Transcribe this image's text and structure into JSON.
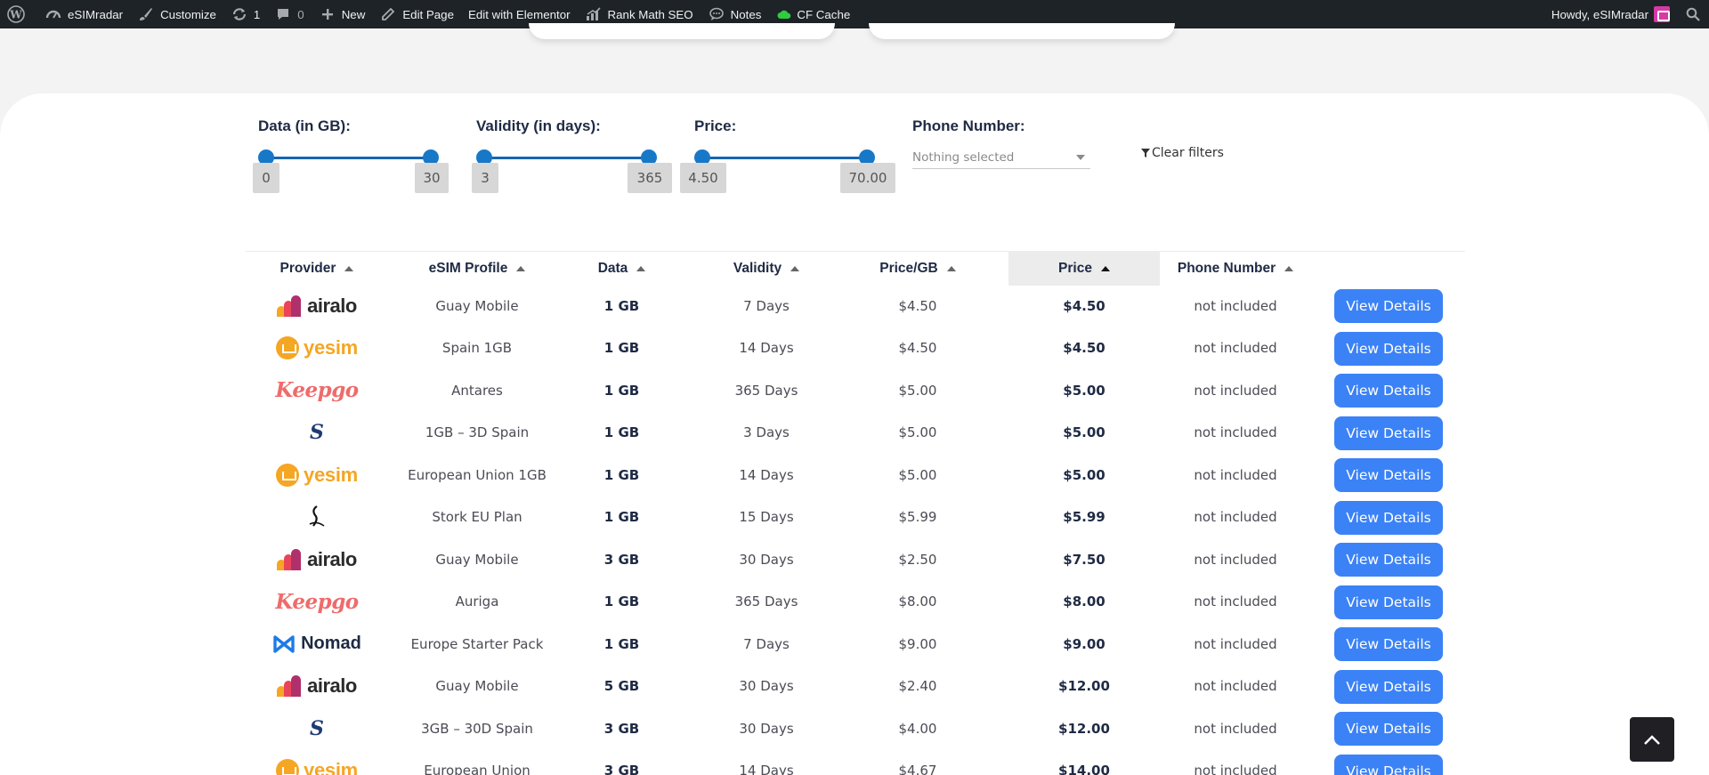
{
  "adminbar": {
    "items": [
      {
        "label": "eSIMradar",
        "icon": "dashboard-icon"
      },
      {
        "label": "Customize",
        "icon": "brush-icon"
      },
      {
        "label": "1",
        "icon": "updates-icon"
      },
      {
        "label": "0",
        "icon": "comments-icon"
      },
      {
        "label": "New",
        "icon": "plus-icon"
      },
      {
        "label": "Edit Page",
        "icon": "pencil-icon"
      },
      {
        "label": "Edit with Elementor",
        "icon": ""
      },
      {
        "label": "Rank Math SEO",
        "icon": "rankmath-icon"
      },
      {
        "label": "Notes",
        "icon": "chat-icon"
      },
      {
        "label": "CF Cache",
        "icon": "cloud-icon"
      }
    ],
    "greeting": "Howdy, eSIMradar"
  },
  "filters": {
    "data": {
      "label": "Data (in GB):",
      "min": "0",
      "max": "30"
    },
    "validity": {
      "label": "Validity (in days):",
      "min": "3",
      "max": "365"
    },
    "price": {
      "label": "Price:",
      "min": "4.50",
      "max": "70.00"
    },
    "phone": {
      "label": "Phone Number:",
      "placeholder": "Nothing selected"
    },
    "clear": "Clear filters"
  },
  "table": {
    "headers": [
      "Provider",
      "eSIM Profile",
      "Data",
      "Validity",
      "Price/GB",
      "Price",
      "Phone Number"
    ],
    "sorted_column": "Price",
    "button_label": "View Details",
    "rows": [
      {
        "provider": "airalo",
        "profile": "Guay Mobile",
        "data": "1 GB",
        "validity": "7 Days",
        "price_gb": "$4.50",
        "price": "$4.50",
        "phone": "not included"
      },
      {
        "provider": "yesim",
        "profile": "Spain 1GB",
        "data": "1 GB",
        "validity": "14 Days",
        "price_gb": "$4.50",
        "price": "$4.50",
        "phone": "not included"
      },
      {
        "provider": "Keepgo",
        "profile": "Antares",
        "data": "1 GB",
        "validity": "365 Days",
        "price_gb": "$5.00",
        "price": "$5.00",
        "phone": "not included"
      },
      {
        "provider": "S",
        "profile": "1GB – 3D Spain",
        "data": "1 GB",
        "validity": "3 Days",
        "price_gb": "$5.00",
        "price": "$5.00",
        "phone": "not included"
      },
      {
        "provider": "yesim",
        "profile": "European Union 1GB",
        "data": "1 GB",
        "validity": "14 Days",
        "price_gb": "$5.00",
        "price": "$5.00",
        "phone": "not included"
      },
      {
        "provider": "Stork",
        "profile": "Stork EU Plan",
        "data": "1 GB",
        "validity": "15 Days",
        "price_gb": "$5.99",
        "price": "$5.99",
        "phone": "not included"
      },
      {
        "provider": "airalo",
        "profile": "Guay Mobile",
        "data": "3 GB",
        "validity": "30 Days",
        "price_gb": "$2.50",
        "price": "$7.50",
        "phone": "not included"
      },
      {
        "provider": "Keepgo",
        "profile": "Auriga",
        "data": "1 GB",
        "validity": "365 Days",
        "price_gb": "$8.00",
        "price": "$8.00",
        "phone": "not included"
      },
      {
        "provider": "Nomad",
        "profile": "Europe Starter Pack",
        "data": "1 GB",
        "validity": "7 Days",
        "price_gb": "$9.00",
        "price": "$9.00",
        "phone": "not included"
      },
      {
        "provider": "airalo",
        "profile": "Guay Mobile",
        "data": "5 GB",
        "validity": "30 Days",
        "price_gb": "$2.40",
        "price": "$12.00",
        "phone": "not included"
      },
      {
        "provider": "S",
        "profile": "3GB – 30D Spain",
        "data": "3 GB",
        "validity": "30 Days",
        "price_gb": "$4.00",
        "price": "$12.00",
        "phone": "not included"
      },
      {
        "provider": "yesim",
        "profile": "European Union",
        "data": "3 GB",
        "validity": "14 Days",
        "price_gb": "$4.67",
        "price": "$14.00",
        "phone": "not included"
      }
    ]
  },
  "colors": {
    "accent": "#3b82f6",
    "slider": "#1878c8",
    "airalo": "#d63a6a",
    "yesim": "#f5a623",
    "keepgo": "#ef6b6b"
  }
}
